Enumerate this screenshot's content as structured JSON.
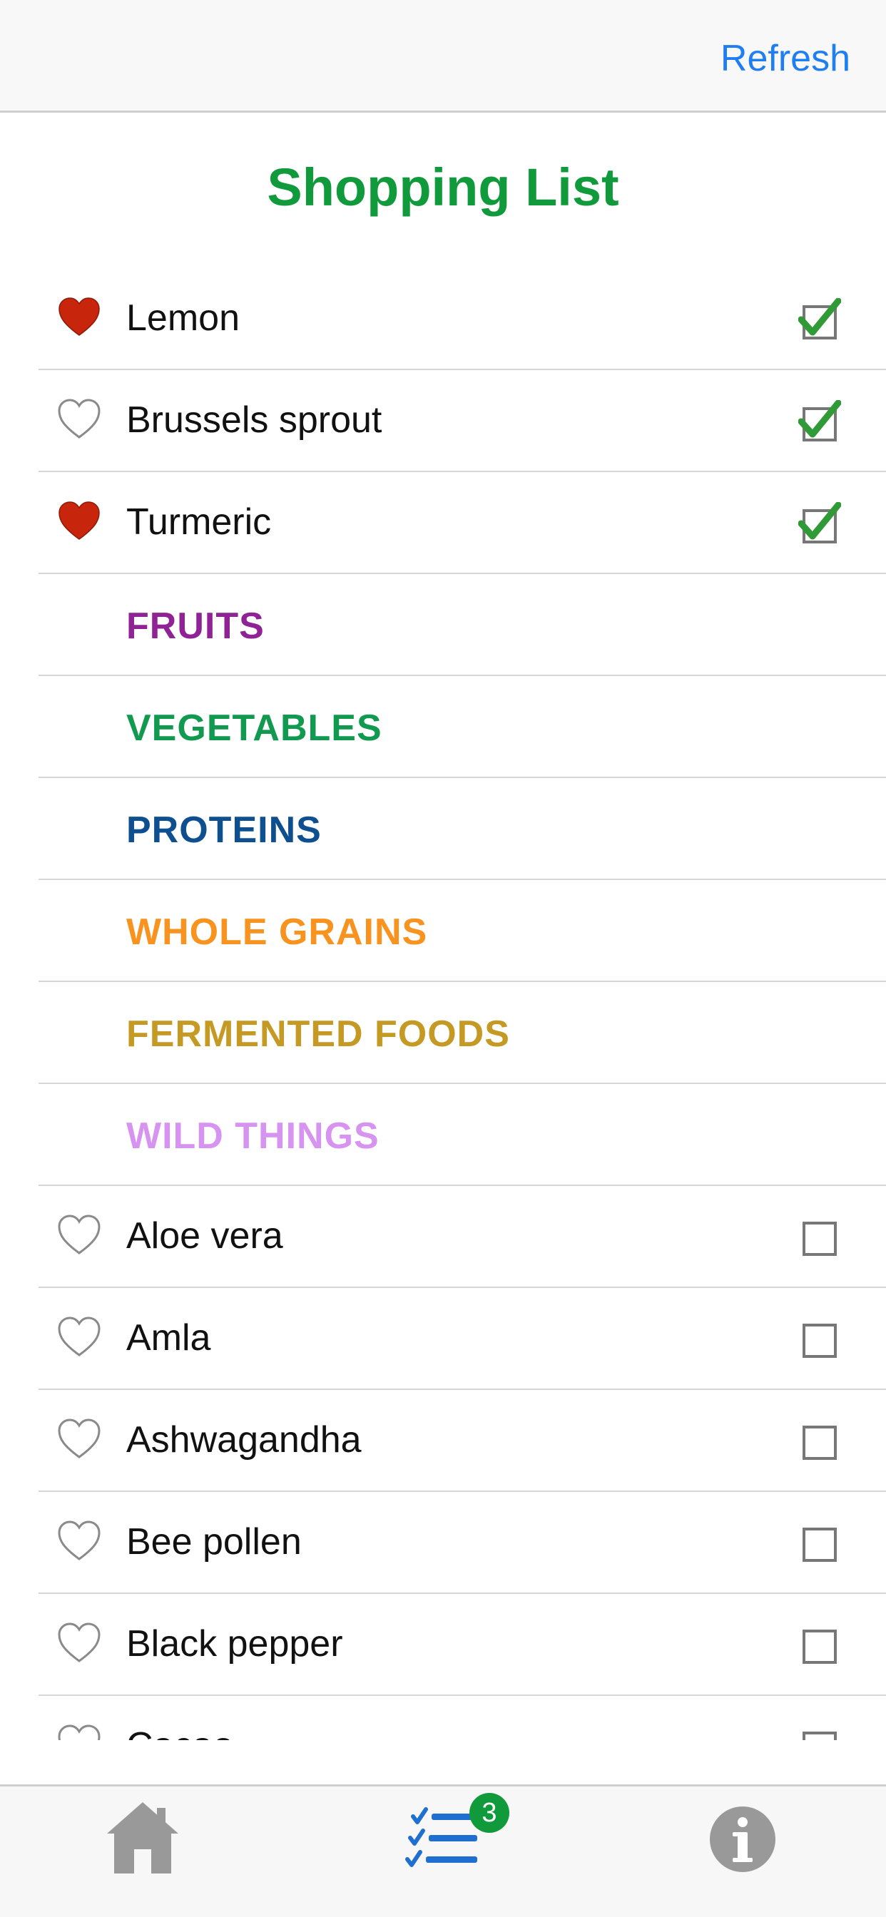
{
  "header": {
    "refresh_label": "Refresh"
  },
  "title": "Shopping List",
  "items_checked": [
    {
      "label": "Lemon",
      "favorite": true,
      "checked": true
    },
    {
      "label": "Brussels sprout",
      "favorite": false,
      "checked": true
    },
    {
      "label": "Turmeric",
      "favorite": true,
      "checked": true
    }
  ],
  "categories": [
    {
      "label": "FRUITS",
      "color": "#8f2294"
    },
    {
      "label": "VEGETABLES",
      "color": "#119a4f"
    },
    {
      "label": "PROTEINS",
      "color": "#0e4f8f"
    },
    {
      "label": "WHOLE GRAINS",
      "color": "#f7931e"
    },
    {
      "label": "FERMENTED FOODS",
      "color": "#c59a24"
    },
    {
      "label": "WILD THINGS",
      "color": "#d693f0"
    }
  ],
  "items_unchecked": [
    {
      "label": "Aloe vera",
      "favorite": false,
      "checked": false
    },
    {
      "label": "Amla",
      "favorite": false,
      "checked": false
    },
    {
      "label": "Ashwagandha",
      "favorite": false,
      "checked": false
    },
    {
      "label": "Bee pollen",
      "favorite": false,
      "checked": false
    },
    {
      "label": "Black pepper",
      "favorite": false,
      "checked": false
    },
    {
      "label": "Cacao",
      "favorite": false,
      "checked": false
    }
  ],
  "tabbar": {
    "tabs": [
      {
        "name": "home",
        "icon": "house-icon"
      },
      {
        "name": "list",
        "icon": "checklist-icon",
        "active": true
      },
      {
        "name": "info",
        "icon": "info-icon"
      }
    ],
    "badge": "3"
  },
  "colors": {
    "accent_blue": "#1f7ef2",
    "title_green": "#119a3c",
    "heart_red": "#c8260c",
    "check_green": "#2f9a36"
  }
}
